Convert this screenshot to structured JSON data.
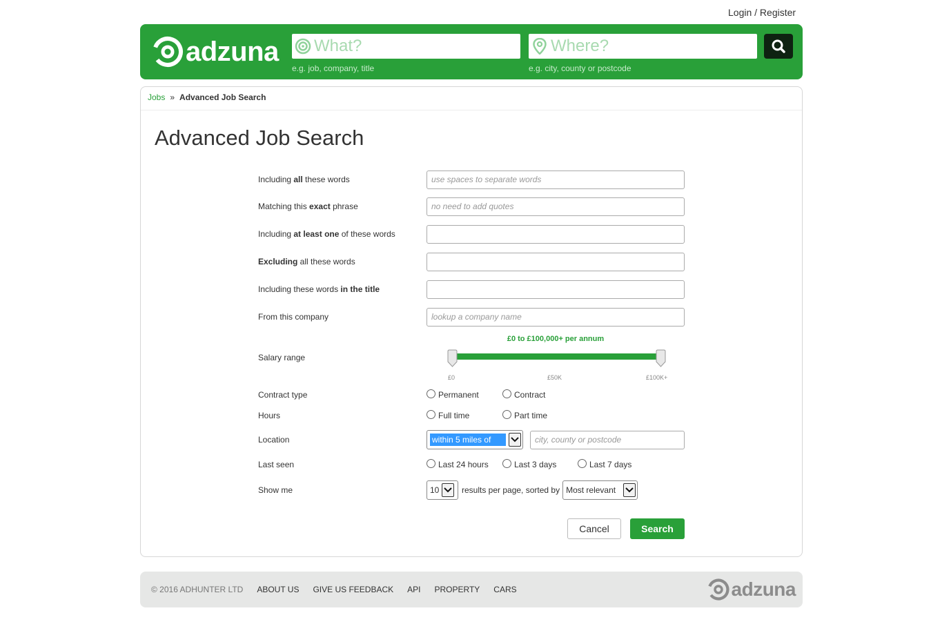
{
  "top": {
    "login_register": "Login / Register"
  },
  "header": {
    "logo_text": "adzuna",
    "what_placeholder": "What?",
    "what_hint": "e.g. job, company, title",
    "where_placeholder": "Where?",
    "where_hint": "e.g. city, county or postcode",
    "brand_color": "#29a039"
  },
  "breadcrumb": {
    "root": "Jobs",
    "separator": "»",
    "current": "Advanced Job Search"
  },
  "page_title": "Advanced Job Search",
  "form": {
    "all_words": {
      "pre": "Including ",
      "bold": "all",
      "post": " these words",
      "placeholder": "use spaces to separate words"
    },
    "exact_phrase": {
      "pre": "Matching this ",
      "bold": "exact",
      "post": " phrase",
      "placeholder": "no need to add quotes"
    },
    "at_least_one": {
      "pre": "Including ",
      "bold": "at least one",
      "post": " of these words",
      "placeholder": ""
    },
    "excluding": {
      "pre": "",
      "bold": "Excluding",
      "post": " all these words",
      "placeholder": ""
    },
    "in_title": {
      "pre": "Including these words ",
      "bold": "in the title",
      "post": "",
      "placeholder": ""
    },
    "company": {
      "label": "From this company",
      "placeholder": "lookup a company name"
    },
    "salary": {
      "label": "Salary range",
      "caption": "£0 to £100,000+ per annum",
      "tick_min": "£0",
      "tick_mid": "£50K",
      "tick_max": "£100K+",
      "range_fraction": [
        0,
        1
      ]
    },
    "contract_type": {
      "label": "Contract type",
      "options": [
        "Permanent",
        "Contract"
      ]
    },
    "hours": {
      "label": "Hours",
      "options": [
        "Full time",
        "Part time"
      ]
    },
    "location": {
      "label": "Location",
      "radius_selected": "within 5 miles of",
      "placeholder": "city, county or postcode"
    },
    "last_seen": {
      "label": "Last seen",
      "options": [
        "Last 24 hours",
        "Last 3 days",
        "Last 7 days"
      ]
    },
    "show_me": {
      "label": "Show me",
      "per_page": "10",
      "mid_text": "results per page, sorted by",
      "sort": "Most relevant"
    },
    "cancel_label": "Cancel",
    "search_label": "Search"
  },
  "footer": {
    "copyright": "© 2016 ADHUNTER LTD",
    "links": [
      "ABOUT US",
      "GIVE US FEEDBACK",
      "API",
      "PROPERTY",
      "CARS"
    ],
    "logo_text": "adzuna"
  }
}
